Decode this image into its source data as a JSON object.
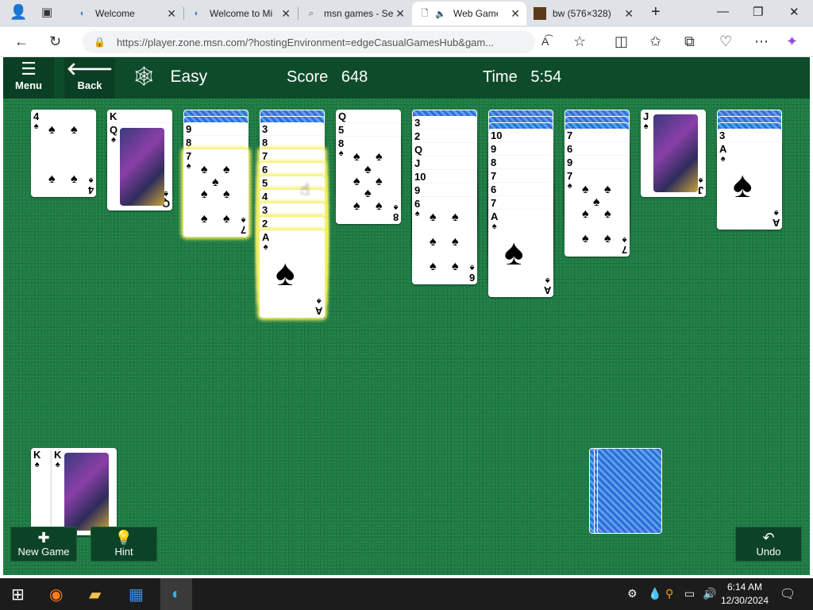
{
  "browser": {
    "tabs": [
      {
        "title": "Welcome"
      },
      {
        "title": "Welcome to Mi"
      },
      {
        "title": "msn games - Se"
      },
      {
        "title": "Web Game"
      },
      {
        "title": "bw (576×328)"
      }
    ],
    "url": "https://player.zone.msn.com/?hostingEnvironment=edgeCasualGamesHub&gam...",
    "new_tab_symbol": "+",
    "minimize": "—",
    "maximize": "❐",
    "close": "✕"
  },
  "game": {
    "menu_label": "Menu",
    "back_label": "Back",
    "difficulty": "Easy",
    "score_label": "Score",
    "score_value": "648",
    "time_label": "Time",
    "time_value": "5:54",
    "new_game_label": "New Game",
    "hint_label": "Hint",
    "undo_label": "Undo",
    "columns": [
      {
        "hidden": 0,
        "ranks": [
          "4"
        ]
      },
      {
        "hidden": 0,
        "ranks": [
          "K",
          "Q"
        ]
      },
      {
        "hidden": 2,
        "ranks": [
          "9",
          "8",
          "7"
        ]
      },
      {
        "hidden": 2,
        "ranks": [
          "3",
          "8",
          "7",
          "6",
          "5",
          "4",
          "3",
          "2",
          "A"
        ]
      },
      {
        "hidden": 0,
        "ranks": [
          "Q",
          "5",
          "8"
        ]
      },
      {
        "hidden": 1,
        "ranks": [
          "3",
          "2",
          "Q",
          "J",
          "10",
          "9",
          "6"
        ]
      },
      {
        "hidden": 3,
        "ranks": [
          "10",
          "9",
          "8",
          "7",
          "6",
          "7",
          "A"
        ]
      },
      {
        "hidden": 3,
        "ranks": [
          "7",
          "6",
          "9",
          "7"
        ]
      },
      {
        "hidden": 0,
        "ranks": [
          "J"
        ]
      },
      {
        "hidden": 3,
        "ranks": [
          "3",
          "A"
        ]
      }
    ],
    "foundation": [
      "K",
      "K"
    ],
    "suit": "♠",
    "colors": {
      "felt": "#1f7a44",
      "header": "#0e4b2a",
      "card_back": "#2b6fd6",
      "highlight": "#f4f06a"
    }
  },
  "taskbar": {
    "time": "6:14 AM",
    "date": "12/30/2024"
  }
}
